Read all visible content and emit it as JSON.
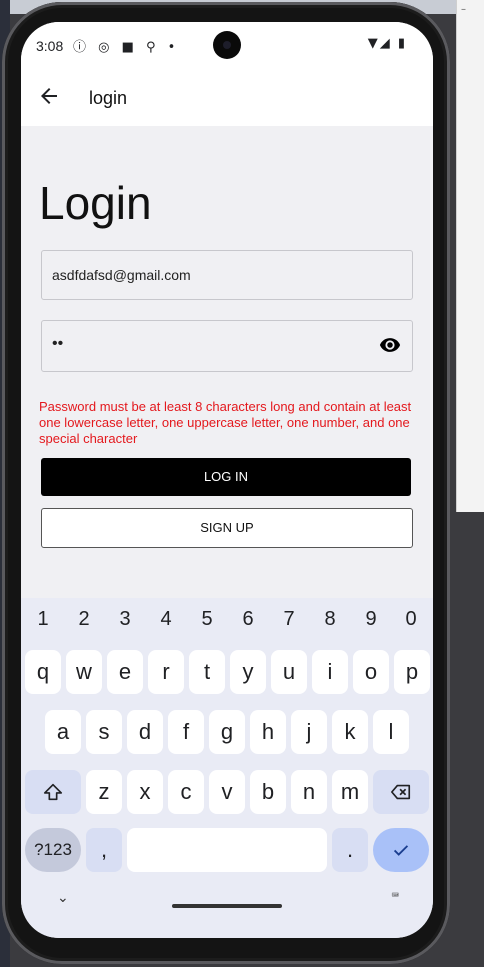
{
  "status_bar": {
    "time": "3:08",
    "icons_left": "ⓘ ◎ ■ ⚲ •",
    "icons_right": "▼◢ ▮"
  },
  "app_bar": {
    "title": "login",
    "back_icon": "arrow-left-icon"
  },
  "page": {
    "heading": "Login",
    "email": {
      "value": "asdfdafsd@gmail.com"
    },
    "password": {
      "value": "••"
    },
    "error": "Password must be at least 8 characters long and contain at least one lowercase letter, one uppercase letter, one number, and one special character",
    "login_button": "LOG IN",
    "signup_button": "SIGN UP"
  },
  "keyboard": {
    "numbers": [
      "1",
      "2",
      "3",
      "4",
      "5",
      "6",
      "7",
      "8",
      "9",
      "0"
    ],
    "row1": [
      "q",
      "w",
      "e",
      "r",
      "t",
      "y",
      "u",
      "i",
      "o",
      "p"
    ],
    "row2": [
      "a",
      "s",
      "d",
      "f",
      "g",
      "h",
      "j",
      "k",
      "l"
    ],
    "row3": [
      "z",
      "x",
      "c",
      "v",
      "b",
      "n",
      "m"
    ],
    "symbols_key": "?123",
    "comma_key": ",",
    "period_key": ".",
    "shift_icon": "shift-icon",
    "backspace_icon": "backspace-icon",
    "enter_icon": "checkmark-icon",
    "hide_icon": "chevron-down-icon",
    "switch_icon": "keyboard-icon"
  },
  "colors": {
    "error": "#e4181d",
    "primary_button": "#000000",
    "enter_key": "#a9c1f8"
  }
}
